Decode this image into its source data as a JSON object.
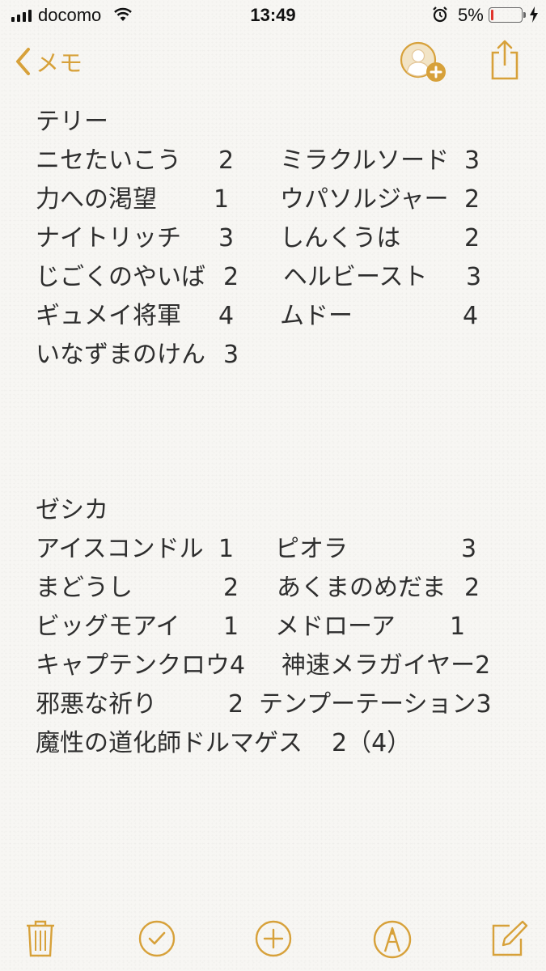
{
  "status_bar": {
    "carrier": "docomo",
    "time": "13:49",
    "battery_percent_text": "5%",
    "battery_level": 0.05,
    "signal_bars": 4
  },
  "nav": {
    "back_label": "メモ",
    "icons": [
      "chevron-left-icon",
      "add-person-icon",
      "share-icon"
    ],
    "accent_color": "#d7a13a"
  },
  "note": {
    "section1": {
      "title": "テリー",
      "rows": [
        {
          "left": "ニセたいこう",
          "left_num": "2",
          "right": "ミラクルソード",
          "right_num": "3"
        },
        {
          "left": "力への渇望",
          "left_num": "1",
          "right": "ウパソルジャー",
          "right_num": "2"
        },
        {
          "left": "ナイトリッチ",
          "left_num": "3",
          "right": "しんくうは",
          "right_num": "2"
        },
        {
          "left": "じごくのやいば",
          "left_num": "2",
          "right": "ヘルビースト",
          "right_num": "3"
        },
        {
          "left": "ギュメイ将軍",
          "left_num": "4",
          "right": "ムドー",
          "right_num": "4"
        },
        {
          "left": "いなずまのけん",
          "left_num": "3"
        }
      ]
    },
    "section2": {
      "title": "ゼシカ",
      "rows": [
        {
          "left": "アイスコンドル",
          "left_num": "1",
          "right": "ピオラ",
          "right_num": "3"
        },
        {
          "left": "まどうし",
          "left_num": "2",
          "right": "あくまのめだま",
          "right_num": "2"
        },
        {
          "left": "ビッグモアイ",
          "left_num": "1",
          "right": "メドローア",
          "right_num": "1"
        },
        {
          "left": "キャプテンクロウ4",
          "right": "神速メラガイヤー2"
        },
        {
          "left": "邪悪な祈り",
          "left_num": "2",
          "right": "テンプーテーション3"
        },
        {
          "left": "魔性の道化師ドルマゲス",
          "left_num": "2（4）"
        }
      ]
    }
  },
  "toolbar": {
    "icons": [
      "trash-icon",
      "checklist-icon",
      "add-icon",
      "markup-icon",
      "compose-icon"
    ]
  }
}
